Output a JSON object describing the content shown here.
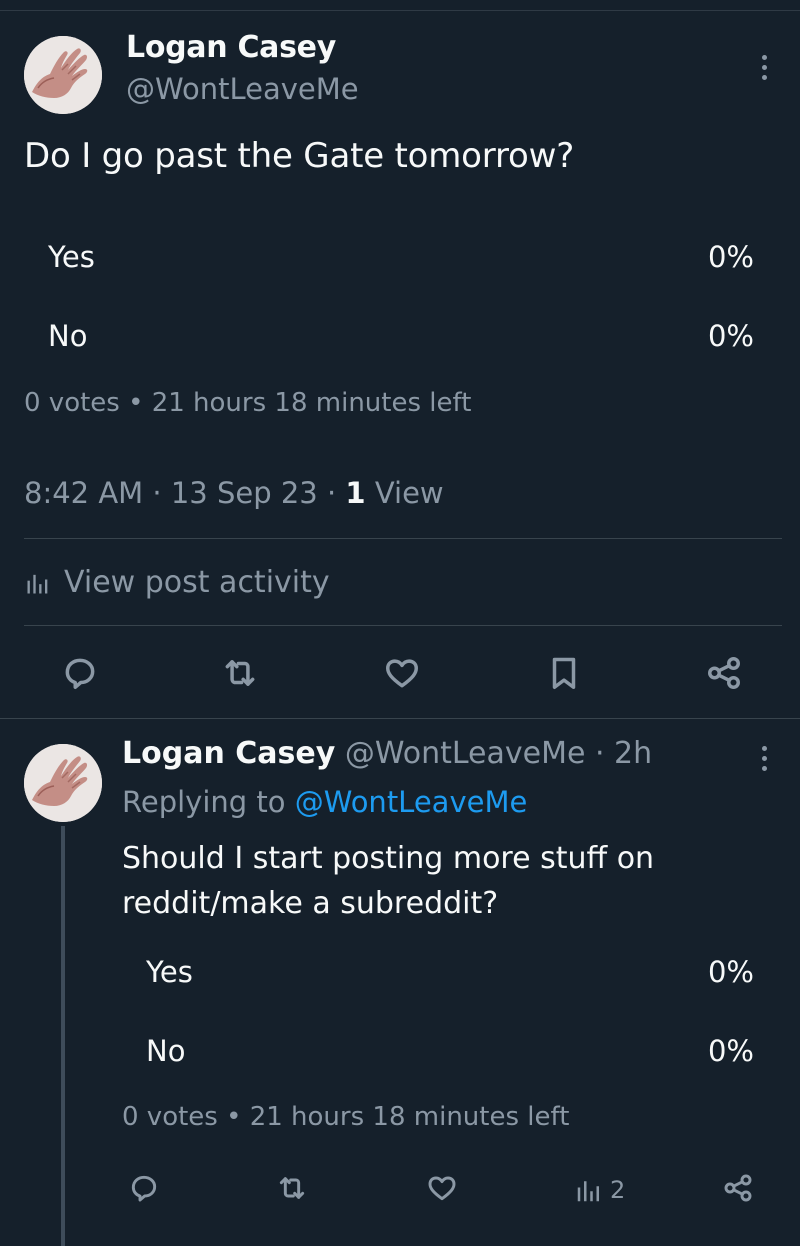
{
  "post": {
    "author_name": "Logan Casey",
    "author_handle": "@WontLeaveMe",
    "text": "Do I go past the Gate tomorrow?",
    "poll": {
      "options": [
        {
          "label": "Yes",
          "percent": "0%"
        },
        {
          "label": "No",
          "percent": "0%"
        }
      ],
      "meta": "0 votes • 21 hours 18 minutes left"
    },
    "timestamp_prefix": "8:42 AM · 13 Sep 23 · ",
    "views_count": "1",
    "views_label": " View",
    "activity_label": "View post activity",
    "icons": [
      "reply-icon",
      "retweet-icon",
      "like-icon",
      "bookmark-icon",
      "share-icon"
    ]
  },
  "reply": {
    "author_name": "Logan Casey",
    "author_handle_time": " @WontLeaveMe · 2h",
    "replying_prefix": "Replying to ",
    "replying_handle": "@WontLeaveMe",
    "text": "Should I start posting more stuff on reddit/make a subreddit?",
    "poll": {
      "options": [
        {
          "label": "Yes",
          "percent": "0%"
        },
        {
          "label": "No",
          "percent": "0%"
        }
      ],
      "meta": "0 votes • 21 hours 18 minutes left"
    },
    "views": "2"
  },
  "colors": {
    "background": "#15202b",
    "text_primary": "#f7f9f9",
    "text_secondary": "#8b98a5",
    "link": "#1d9bf0",
    "divider": "#38444d"
  }
}
